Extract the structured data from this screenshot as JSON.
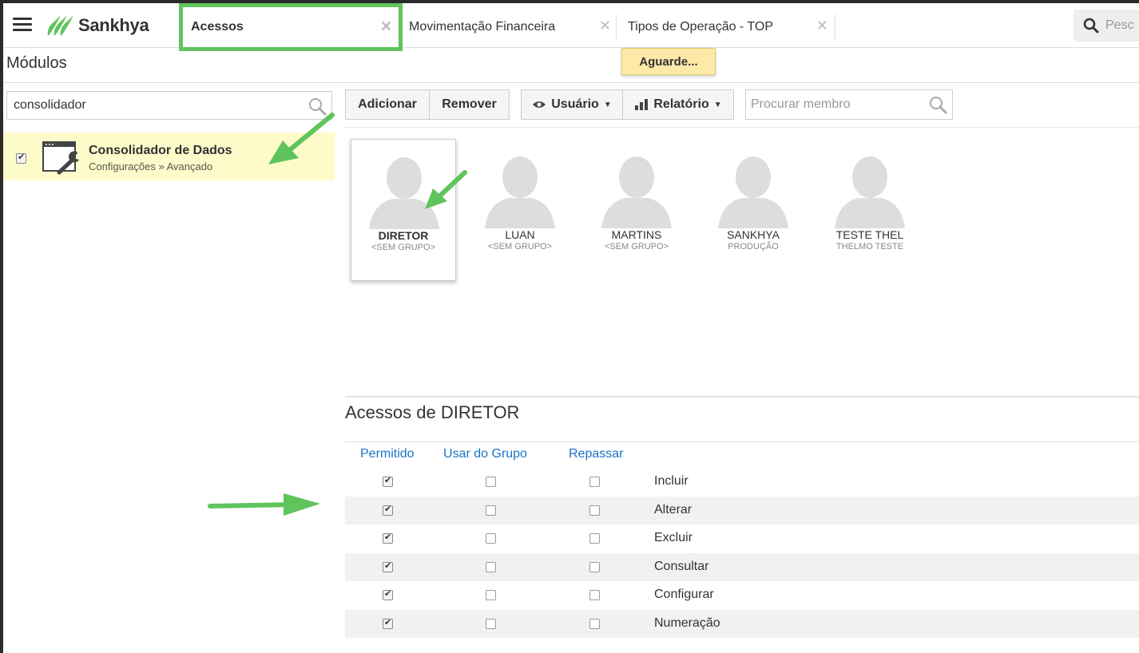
{
  "brand": {
    "name": "Sankhya",
    "accent": "#5fc45c"
  },
  "tabs": [
    {
      "label": "Acessos",
      "active": true
    },
    {
      "label": "Movimentação Financeira",
      "active": false
    },
    {
      "label": "Tipos de Operação - TOP",
      "active": false
    }
  ],
  "global_search": {
    "placeholder": "Pesc"
  },
  "modules": {
    "title": "Módulos",
    "search_value": "consolidador",
    "item": {
      "name": "Consolidador de Dados",
      "path": "Configurações » Avançado",
      "checked": true
    }
  },
  "notice": "Aguarde...",
  "toolbar": {
    "add": "Adicionar",
    "remove": "Remover",
    "user": "Usuário",
    "report": "Relatório",
    "member_search_placeholder": "Procurar membro"
  },
  "members": [
    {
      "name": "DIRETOR",
      "group": "<SEM GRUPO>",
      "selected": true
    },
    {
      "name": "LUAN",
      "group": "<SEM GRUPO>",
      "selected": false
    },
    {
      "name": "MARTINS",
      "group": "<SEM GRUPO>",
      "selected": false
    },
    {
      "name": "SANKHYA",
      "group": "PRODUÇÃO",
      "selected": false
    },
    {
      "name": "TESTE THEL",
      "group": "THELMO TESTE",
      "selected": false
    }
  ],
  "access": {
    "title": "Acessos de DIRETOR",
    "columns": [
      "Permitido",
      "Usar do Grupo",
      "Repassar"
    ],
    "rows": [
      {
        "label": "Incluir",
        "permitido": true,
        "usar_grupo": false,
        "repassar": false
      },
      {
        "label": "Alterar",
        "permitido": true,
        "usar_grupo": false,
        "repassar": false
      },
      {
        "label": "Excluir",
        "permitido": true,
        "usar_grupo": false,
        "repassar": false
      },
      {
        "label": "Consultar",
        "permitido": true,
        "usar_grupo": false,
        "repassar": false
      },
      {
        "label": "Configurar",
        "permitido": true,
        "usar_grupo": false,
        "repassar": false
      },
      {
        "label": "Numeração",
        "permitido": true,
        "usar_grupo": false,
        "repassar": false
      }
    ]
  }
}
